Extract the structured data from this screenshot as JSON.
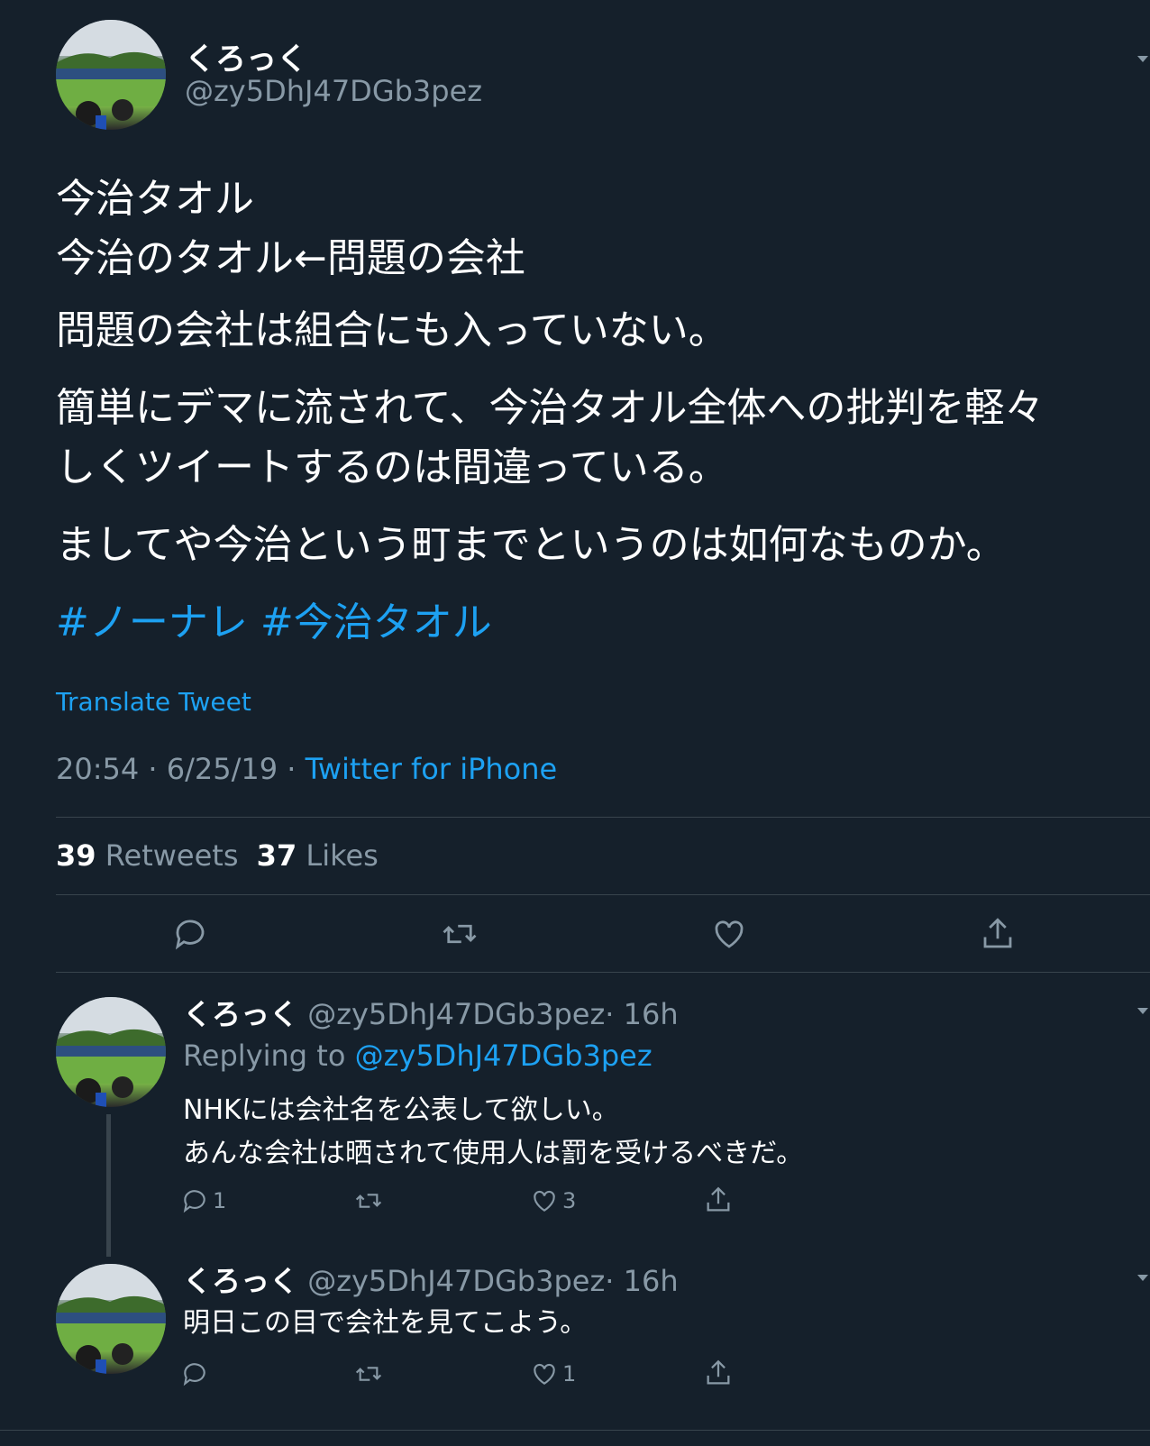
{
  "main_tweet": {
    "display_name": "くろっく",
    "handle": "@zy5DhJ47DGb3pez",
    "body": {
      "line1": "今治タオル",
      "line2": "今治のタオル←問題の会社",
      "line3": "問題の会社は組合にも入っていない。",
      "line4": "簡単にデマに流されて、今治タオル全体への批判を軽々",
      "line5": "しくツイートするのは間違っている。",
      "line6": "ましてや今治という町までというのは如何なものか。"
    },
    "hashtags": [
      "#ノーナレ",
      "#今治タオル"
    ],
    "translate": "Translate Tweet",
    "timestamp": "20:54 · 6/25/19 · ",
    "source": "Twitter for iPhone",
    "retweets_count": "39",
    "retweets_label": "Retweets",
    "likes_count": "37",
    "likes_label": "Likes"
  },
  "replies": [
    {
      "display_name": "くろっく",
      "handle": "@zy5DhJ47DGb3pez",
      "time": "· 16h",
      "replying_prefix": "Replying to",
      "replying_to": "@zy5DhJ47DGb3pez",
      "text1": "NHKには会社名を公表して欲しい。",
      "text2": "あんな会社は晒されて使用人は罰を受けるべきだ。",
      "reply_count": "1",
      "retweet_count": "",
      "like_count": "3"
    },
    {
      "display_name": "くろっく",
      "handle": "@zy5DhJ47DGb3pez",
      "time": "· 16h",
      "text1": "明日この目で会社を見てこよう。",
      "reply_count": "",
      "retweet_count": "",
      "like_count": "1"
    }
  ],
  "icons": [
    "reply-icon",
    "retweet-icon",
    "like-icon",
    "share-icon",
    "chevron-down-icon"
  ],
  "colors": {
    "background": "#15202b",
    "link": "#1da1f2",
    "muted": "#8899a6",
    "divider": "#38444d"
  }
}
